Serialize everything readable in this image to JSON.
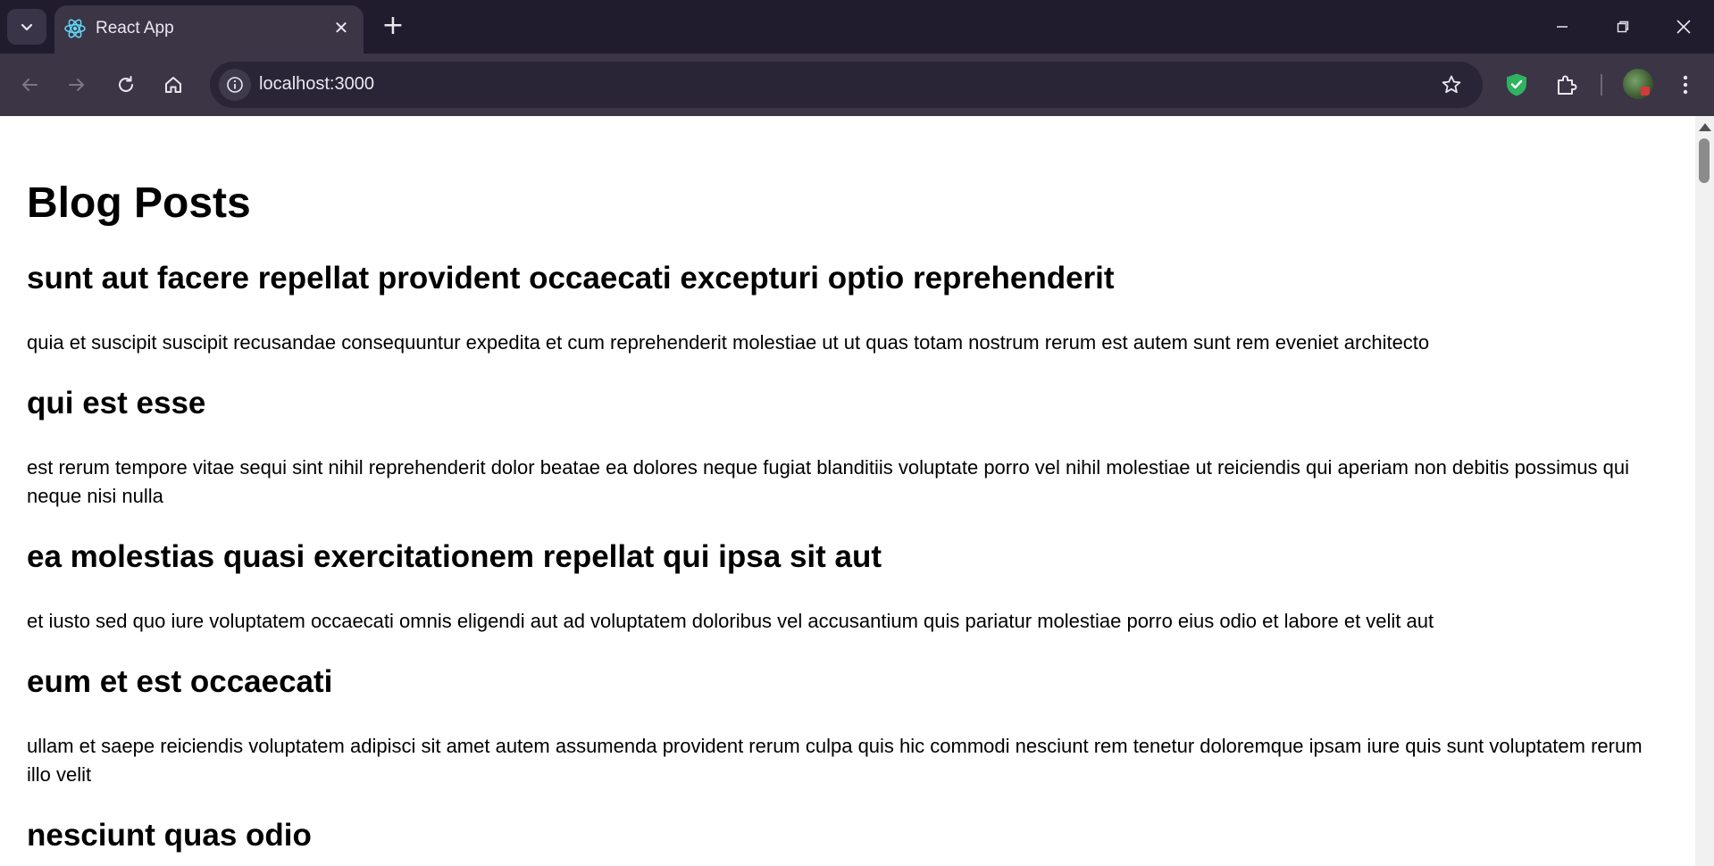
{
  "browser": {
    "tab_title": "React App",
    "url": "localhost:3000",
    "icons": {
      "tab_search": "chevron-down-icon",
      "favicon": "react-icon",
      "tab_close": "close-icon",
      "new_tab": "plus-icon",
      "back": "back-arrow-icon",
      "forward": "forward-arrow-icon",
      "reload": "reload-icon",
      "home": "home-icon",
      "site_info": "info-icon",
      "bookmark": "star-icon",
      "shield_extension": "shield-icon",
      "extensions": "puzzle-icon",
      "menu": "kebab-menu-icon"
    }
  },
  "page": {
    "heading": "Blog Posts",
    "posts": [
      {
        "title": "sunt aut facere repellat provident occaecati excepturi optio reprehenderit",
        "body": "quia et suscipit suscipit recusandae consequuntur expedita et cum reprehenderit molestiae ut ut quas totam nostrum rerum est autem sunt rem eveniet architecto"
      },
      {
        "title": "qui est esse",
        "body": "est rerum tempore vitae sequi sint nihil reprehenderit dolor beatae ea dolores neque fugiat blanditiis voluptate porro vel nihil molestiae ut reiciendis qui aperiam non debitis possimus qui neque nisi nulla"
      },
      {
        "title": "ea molestias quasi exercitationem repellat qui ipsa sit aut",
        "body": "et iusto sed quo iure voluptatem occaecati omnis eligendi aut ad voluptatem doloribus vel accusantium quis pariatur molestiae porro eius odio et labore et velit aut"
      },
      {
        "title": "eum et est occaecati",
        "body": "ullam et saepe reiciendis voluptatem adipisci sit amet autem assumenda provident rerum culpa quis hic commodi nesciunt rem tenetur doloremque ipsam iure quis sunt voluptatem rerum illo velit"
      },
      {
        "title": "nesciunt quas odio",
        "body": ""
      }
    ]
  },
  "colors": {
    "titlebar": "#201b2d",
    "toolbar": "#3b3546",
    "omnibox": "#2a2536",
    "shield_green": "#2fb360",
    "react_blue": "#61dafb"
  }
}
